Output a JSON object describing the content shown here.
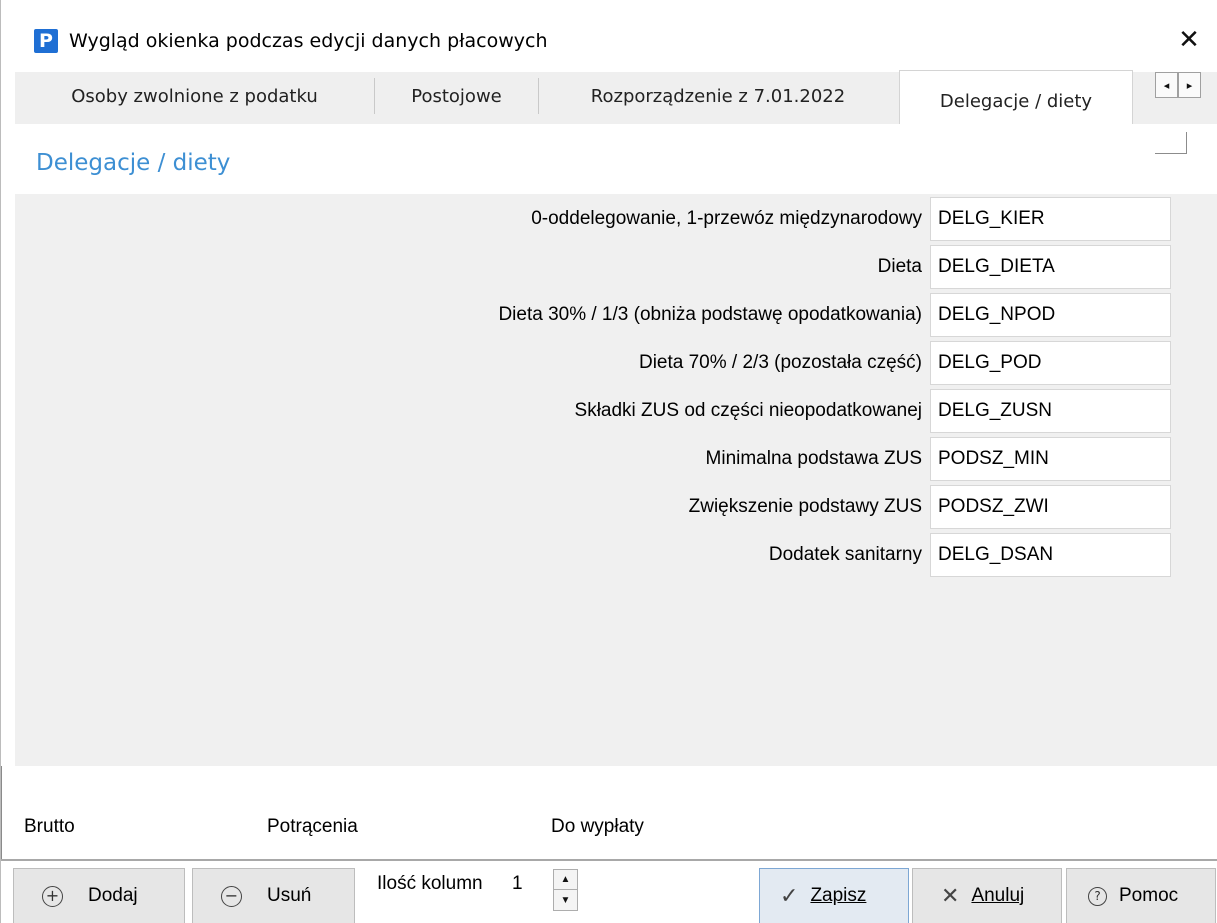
{
  "window": {
    "title": "Wygląd okienka podczas edycji danych płacowych",
    "icon_letter": "P",
    "close_glyph": "✕",
    "accent_color": "#1f6fd4"
  },
  "tabs": [
    {
      "label": "Osoby zwolnione z podatku",
      "active": false
    },
    {
      "label": "Postojowe",
      "active": false
    },
    {
      "label": "Rozporządzenie z 7.01.2022",
      "active": false
    },
    {
      "label": "Delegacje / diety",
      "active": true
    }
  ],
  "tab_scroll": {
    "left_glyph": "◂",
    "right_glyph": "▸"
  },
  "section": {
    "title": "Delegacje / diety",
    "title_color": "#3d8fd3"
  },
  "fields": [
    {
      "label": "0-oddelegowanie, 1-przewóz międzynarodowy",
      "value": "DELG_KIER"
    },
    {
      "label": "Dieta",
      "value": "DELG_DIETA"
    },
    {
      "label": "Dieta 30% / 1/3 (obniża podstawę opodatkowania)",
      "value": "DELG_NPOD"
    },
    {
      "label": "Dieta 70% / 2/3 (pozostała część)",
      "value": "DELG_POD"
    },
    {
      "label": "Składki ZUS od części nieopodatkowanej",
      "value": "DELG_ZUSN"
    },
    {
      "label": "Minimalna podstawa ZUS",
      "value": "PODSZ_MIN"
    },
    {
      "label": "Zwiększenie podstawy ZUS",
      "value": "PODSZ_ZWI"
    },
    {
      "label": "Dodatek sanitarny",
      "value": "DELG_DSAN"
    }
  ],
  "totals": {
    "brutto": "Brutto",
    "potracenia": "Potrącenia",
    "do_wyplaty": "Do wypłaty"
  },
  "toolbar": {
    "add_label": "Dodaj",
    "add_icon": "plus-circle-icon",
    "remove_label": "Usuń",
    "remove_icon": "minus-circle-icon",
    "columns_label": "Ilość kolumn",
    "columns_value": "1",
    "save_label": "Zapisz",
    "save_icon": "checkmark-icon",
    "cancel_label": "Anuluj",
    "cancel_icon": "x-icon",
    "help_label": "Pomoc",
    "help_icon": "question-circle-icon"
  }
}
